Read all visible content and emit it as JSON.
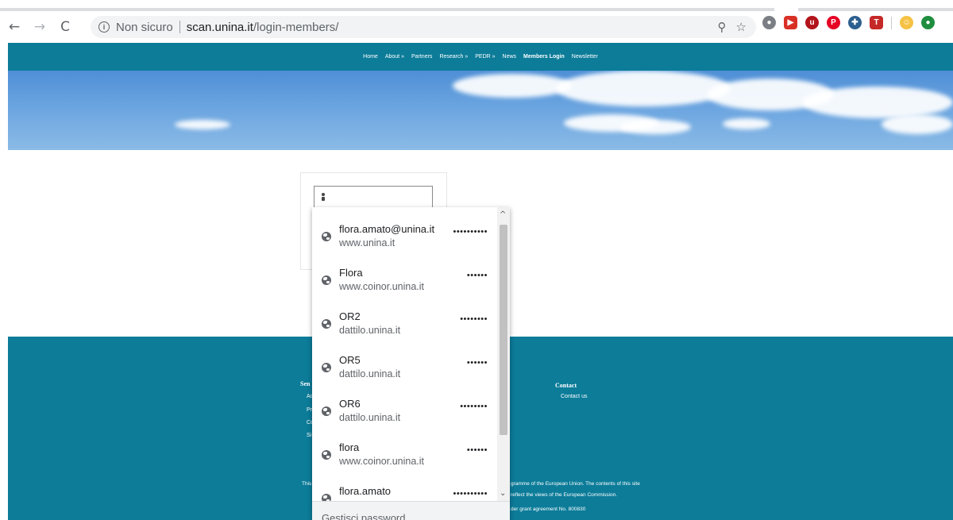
{
  "browser": {
    "nav": {
      "back": "←",
      "forward": "→",
      "reload": "C"
    },
    "omnibox": {
      "insecure_label": "Non sicuro",
      "host": "scan.unina.it",
      "path": "/login-members/"
    },
    "omni_icons": [
      "zoom-icon",
      "bookmark-star-icon"
    ],
    "extensions": [
      {
        "name": "extension-speech-icon",
        "color": "#7b7f85",
        "glyph": "●"
      },
      {
        "name": "extension-red-play-icon",
        "color": "#d93025",
        "glyph": "▶"
      },
      {
        "name": "extension-ublock-icon",
        "color": "#b3141b",
        "glyph": "u"
      },
      {
        "name": "extension-pinterest-icon",
        "color": "#e60023",
        "glyph": "P"
      },
      {
        "name": "extension-blue-gear-icon",
        "color": "#2b5f8f",
        "glyph": "✚"
      },
      {
        "name": "extension-t-icon",
        "color": "#c62828",
        "glyph": "T"
      },
      {
        "name": "extension-emoji-icon",
        "color": "#f6c244",
        "glyph": "☺"
      },
      {
        "name": "extension-green-icon",
        "color": "#1e8e3e",
        "glyph": "●"
      }
    ]
  },
  "site": {
    "nav_items": [
      {
        "label": "Home",
        "active": false
      },
      {
        "label": "About »",
        "active": false
      },
      {
        "label": "Partners",
        "active": false
      },
      {
        "label": "Research »",
        "active": false
      },
      {
        "label": "PEDR »",
        "active": false
      },
      {
        "label": "News",
        "active": false
      },
      {
        "label": "Members Login",
        "active": true
      },
      {
        "label": "Newsletter",
        "active": false
      }
    ],
    "footer": {
      "col1_title": "Sen",
      "col1_links": [
        "Ac",
        "Pr",
        "Co",
        "Si"
      ],
      "col2_title": "Contact",
      "col2_links": [
        "Contact us"
      ],
      "left_fragment": "This",
      "funding_line1": "gramme of the European Union. The contents of this site",
      "funding_line2": "reflect the views of the European Commission.",
      "funding_line3": "der grant agreement No. 800830"
    }
  },
  "autofill": {
    "entries": [
      {
        "username": "flora.amato@unina.it",
        "site": "www.unina.it",
        "password_mask": "••••••••••"
      },
      {
        "username": "Flora",
        "site": "www.coinor.unina.it",
        "password_mask": "••••••"
      },
      {
        "username": "OR2",
        "site": "dattilo.unina.it",
        "password_mask": "••••••••"
      },
      {
        "username": "OR5",
        "site": "dattilo.unina.it",
        "password_mask": "••••••"
      },
      {
        "username": "OR6",
        "site": "dattilo.unina.it",
        "password_mask": "••••••••"
      },
      {
        "username": "flora",
        "site": "www.coinor.unina.it",
        "password_mask": "••••••"
      },
      {
        "username": "flora.amato",
        "site": "",
        "password_mask": "••••••••••"
      }
    ],
    "manage_label": "Gestisci password"
  }
}
